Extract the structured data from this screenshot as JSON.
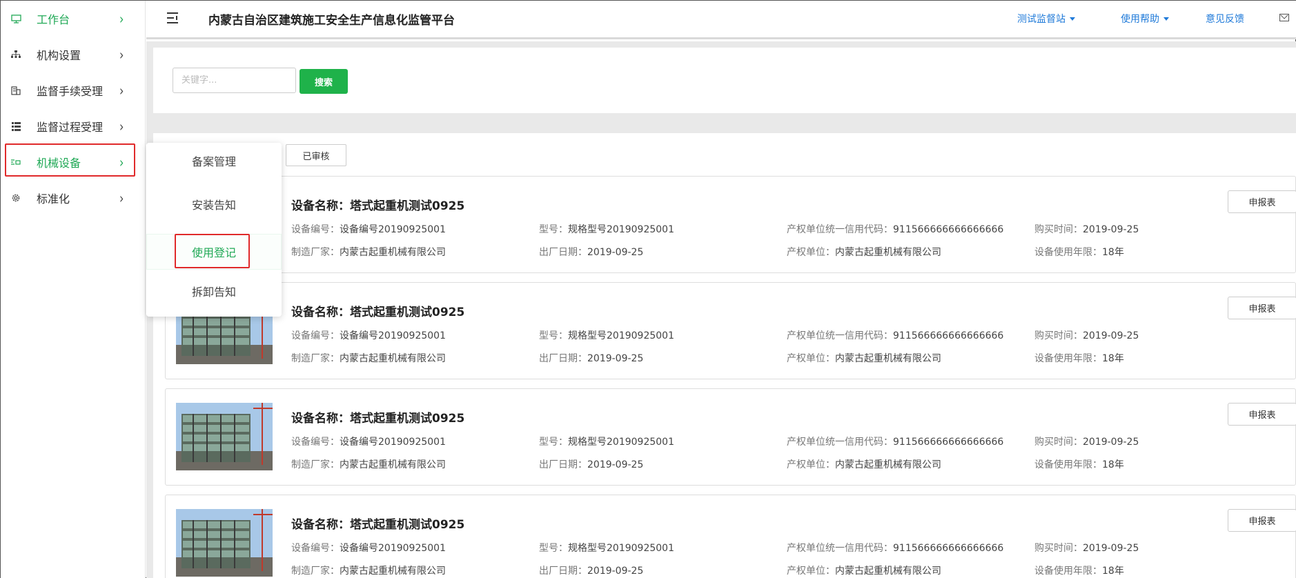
{
  "header": {
    "title": "内蒙古自治区建筑施工安全生产信息化监管平台",
    "station": "测试监督站",
    "help": "使用帮助",
    "feedback": "意见反馈"
  },
  "sidebar": {
    "items": [
      {
        "label": "工作台",
        "icon": "monitor-icon"
      },
      {
        "label": "机构设置",
        "icon": "org-chart-icon"
      },
      {
        "label": "监督手续受理",
        "icon": "building-icon"
      },
      {
        "label": "监督过程受理",
        "icon": "list-icon"
      },
      {
        "label": "机械设备",
        "icon": "machine-icon"
      },
      {
        "label": "标准化",
        "icon": "gear-icon"
      }
    ]
  },
  "submenu": {
    "items": [
      {
        "label": "备案管理"
      },
      {
        "label": "安装告知"
      },
      {
        "label": "使用登记"
      },
      {
        "label": "拆卸告知"
      }
    ]
  },
  "search": {
    "placeholder": "关键字...",
    "button": "搜索"
  },
  "tabs": [
    {
      "label": "已审核"
    }
  ],
  "labels": {
    "name": "设备名称：",
    "code": "设备编号：",
    "model": "型号：",
    "credit": "产权单位统一信用代码：",
    "buy_date": "购买时间：",
    "maker": "制造厂家：",
    "factory_date": "出厂日期：",
    "owner": "产权单位：",
    "years": "设备使用年限：",
    "report": "申报表"
  },
  "devices": [
    {
      "name": "塔式起重机测试0925",
      "code": "设备编号20190925001",
      "model": "规格型号20190925001",
      "credit": "911566666666666666",
      "buy_date": "2019-09-25",
      "maker": "内蒙古起重机械有限公司",
      "factory_date": "2019-09-25",
      "owner": "内蒙古起重机械有限公司",
      "years": "18年"
    },
    {
      "name": "塔式起重机测试0925",
      "code": "设备编号20190925001",
      "model": "规格型号20190925001",
      "credit": "911566666666666666",
      "buy_date": "2019-09-25",
      "maker": "内蒙古起重机械有限公司",
      "factory_date": "2019-09-25",
      "owner": "内蒙古起重机械有限公司",
      "years": "18年"
    },
    {
      "name": "塔式起重机测试0925",
      "code": "设备编号20190925001",
      "model": "规格型号20190925001",
      "credit": "911566666666666666",
      "buy_date": "2019-09-25",
      "maker": "内蒙古起重机械有限公司",
      "factory_date": "2019-09-25",
      "owner": "内蒙古起重机械有限公司",
      "years": "18年"
    },
    {
      "name": "塔式起重机测试0925",
      "code": "设备编号20190925001",
      "model": "规格型号20190925001",
      "credit": "911566666666666666",
      "buy_date": "2019-09-25",
      "maker": "内蒙古起重机械有限公司",
      "factory_date": "2019-09-25",
      "owner": "内蒙古起重机械有限公司",
      "years": "18年"
    }
  ],
  "colors": {
    "accent": "#1fa855",
    "link": "#1f7ad9",
    "highlight": "#e0292a",
    "search_button": "#1fb24a"
  }
}
